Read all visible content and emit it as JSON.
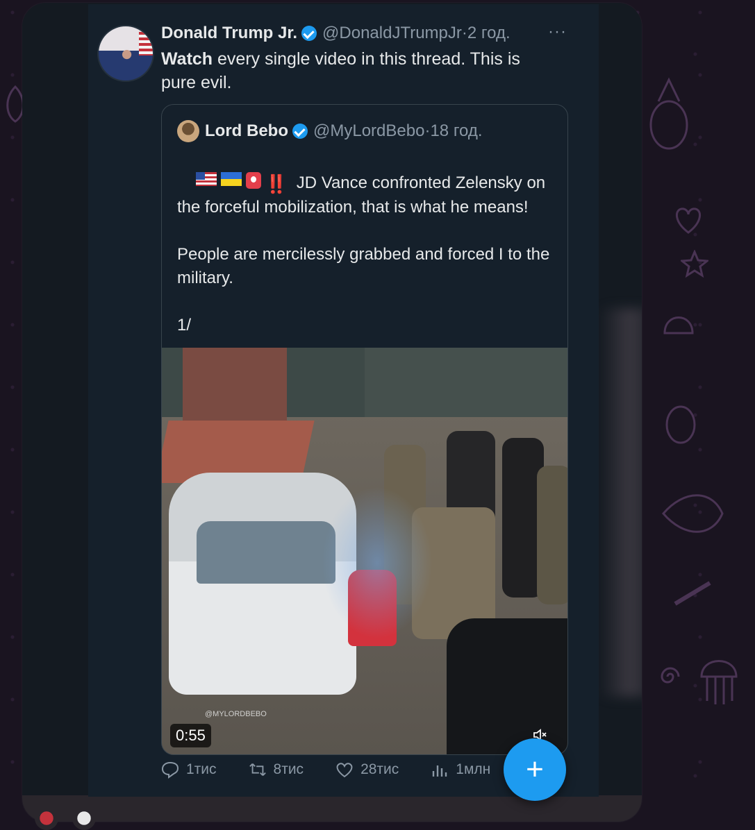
{
  "tweet": {
    "author_name": "Donald Trump Jr.",
    "author_handle": "@DonaldJTrumpJr",
    "separator": " · ",
    "time": "2 год.",
    "more": "···",
    "text_bold": "Watch",
    "text_rest": " every single video in this thread. This is pure evil."
  },
  "quote": {
    "author_name": "Lord Bebo",
    "author_handle": "@MyLordBebo",
    "separator": " · ",
    "time": "18 год.",
    "emoji_bang": "‼️",
    "text_first": " JD Vance confronted Zelensky on the forceful mobilization, that is what he means!",
    "text_rest": "People are mercilessly grabbed and forced I to the military.\n\n1/",
    "video": {
      "duration": "0:55",
      "watermark": "@MYLORDBEBO"
    }
  },
  "actions": {
    "replies": "1тис",
    "retweets": "8тис",
    "likes": "28тис",
    "views": "1млн"
  },
  "fab": {
    "label": "+"
  },
  "colors": {
    "accent": "#1d9bf0",
    "card_bg": "#15202b",
    "muted": "#8b98a5"
  }
}
